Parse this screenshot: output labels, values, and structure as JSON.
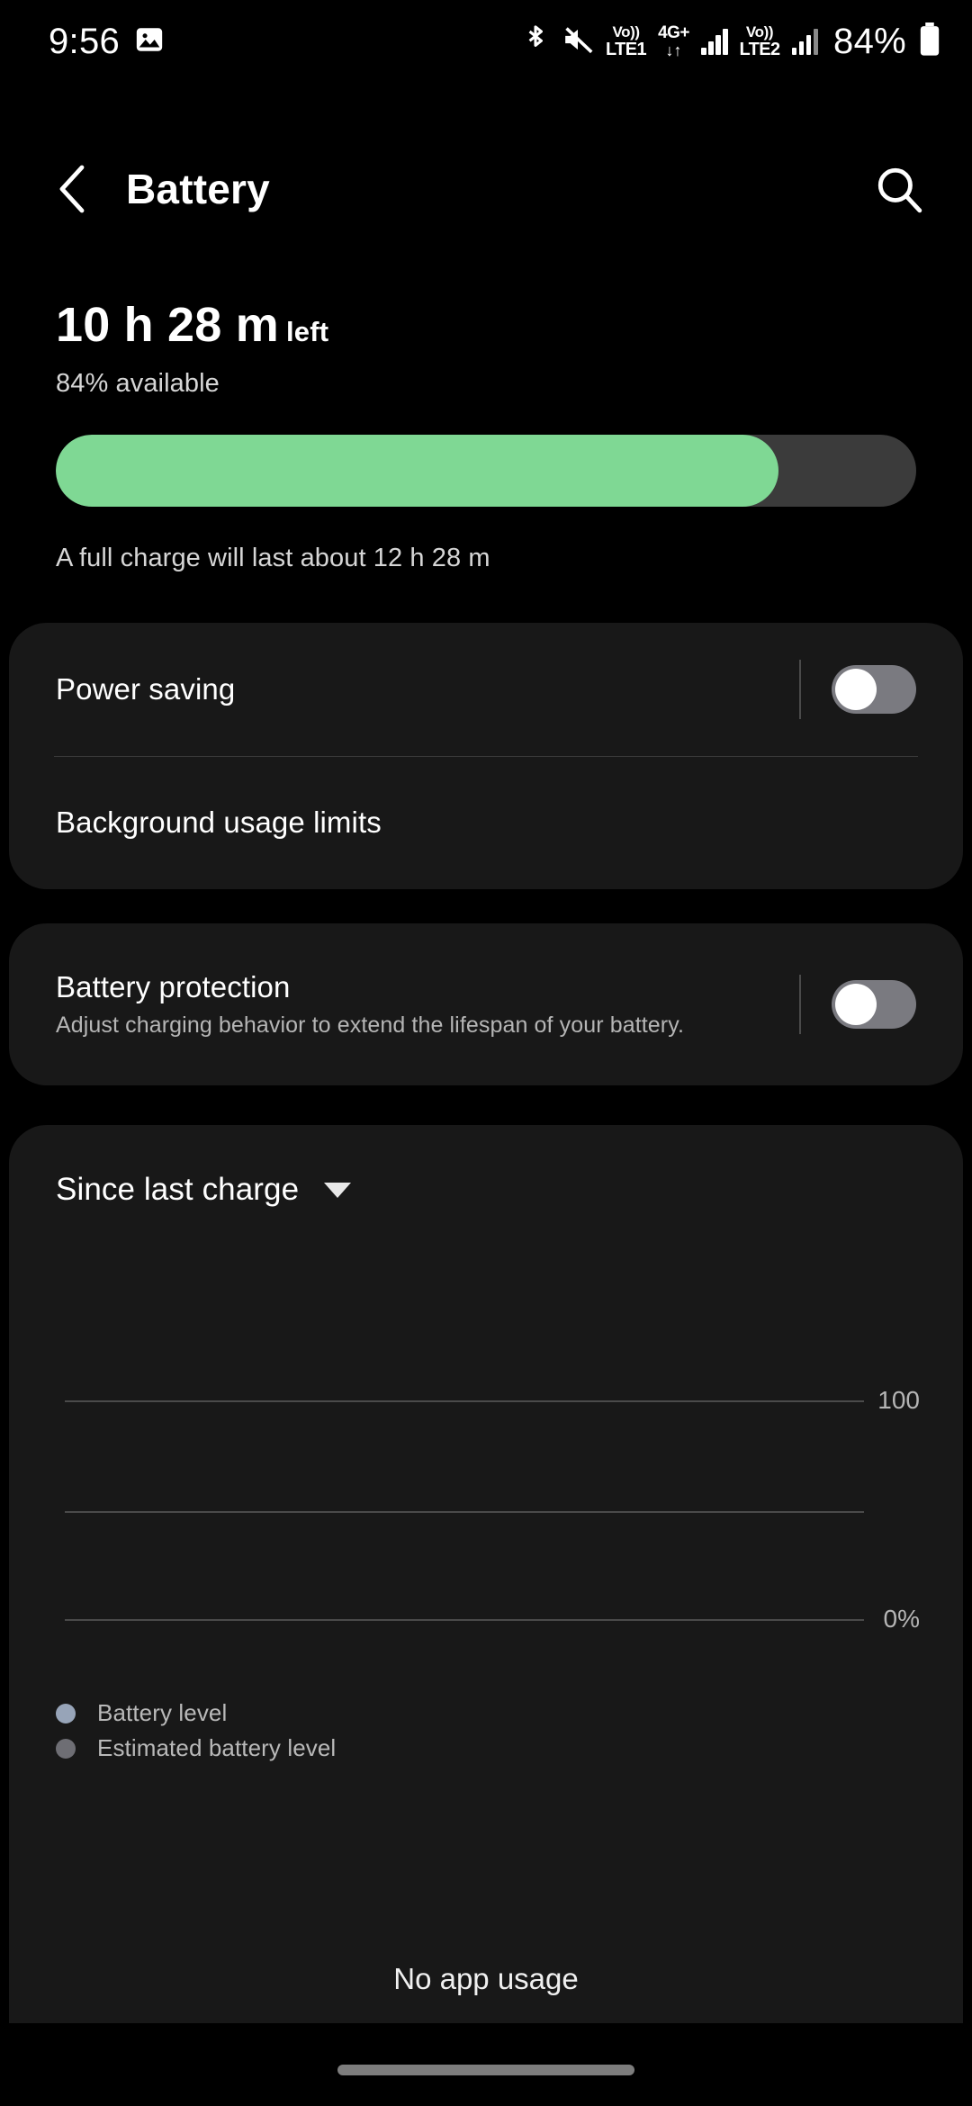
{
  "status_bar": {
    "time": "9:56",
    "icons": [
      "image-icon",
      "bluetooth-icon",
      "mute-icon",
      "volte-sim1-icon",
      "network-4gplus-icon",
      "signal-sim1-icon",
      "volte-sim2-icon",
      "signal-sim2-icon",
      "battery-icon"
    ],
    "volte1_top": "Vo))",
    "volte1_bottom": "LTE1",
    "network_top": "4G+",
    "network_bottom": "↓↑",
    "volte2_top": "Vo))",
    "volte2_bottom": "LTE2",
    "battery_percent": "84%"
  },
  "header": {
    "back_icon": "chevron-left-icon",
    "title": "Battery",
    "search_icon": "search-icon"
  },
  "summary": {
    "time_left_value": "10 h 28 m",
    "time_left_unit": "left",
    "available": "84% available",
    "progress_percent": 84,
    "progress_color": "#7fd894",
    "track_color": "#3b3b3b",
    "full_charge_note": "A full charge will last about 12 h 28 m"
  },
  "power_card": {
    "power_saving_label": "Power saving",
    "power_saving_on": false,
    "background_usage_label": "Background usage limits"
  },
  "protection_card": {
    "label": "Battery protection",
    "description": "Adjust charging behavior to extend the lifespan of your battery.",
    "enabled": false
  },
  "chart_card": {
    "period_label": "Since last charge",
    "period_caret_icon": "chevron-down-icon",
    "no_app_usage": "No app usage"
  },
  "chart_data": {
    "type": "line",
    "title": "Since last charge",
    "xlabel": "",
    "ylabel": "",
    "ylim": [
      0,
      100
    ],
    "yticks": [
      100,
      50,
      0
    ],
    "ytick_labels": [
      "100",
      "",
      "0%"
    ],
    "grid": true,
    "legend_position": "bottom-left",
    "series": [
      {
        "name": "Battery level",
        "color": "#97a4b8",
        "x": [],
        "values": []
      },
      {
        "name": "Estimated battery level",
        "color": "#6e6e74",
        "x": [],
        "values": []
      }
    ]
  },
  "navigation": {
    "pill": "home-gesture-pill"
  }
}
